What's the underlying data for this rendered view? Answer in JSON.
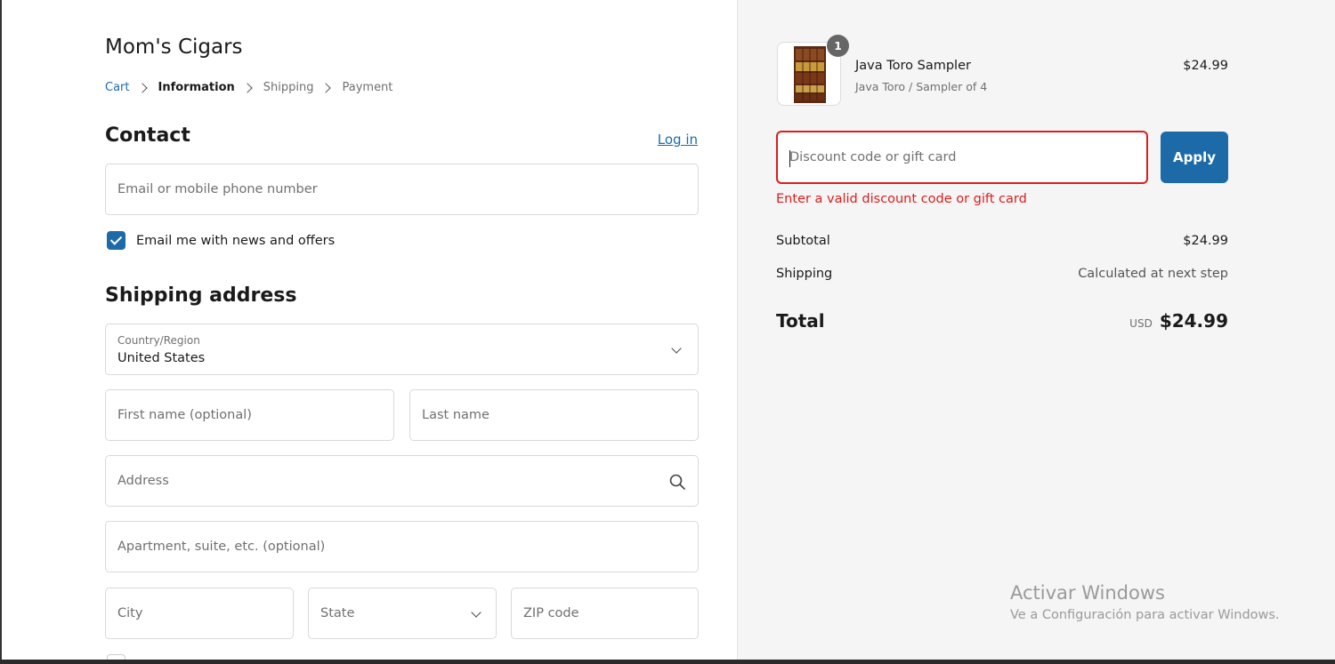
{
  "shop": {
    "name": "Mom's Cigars"
  },
  "breadcrumb": [
    "Cart",
    "Information",
    "Shipping",
    "Payment"
  ],
  "contact": {
    "title": "Contact",
    "login_label": "Log in",
    "email_placeholder": "Email or mobile phone number",
    "newsletter_label": "Email me with news and offers",
    "newsletter_checked": true
  },
  "shipping": {
    "title": "Shipping address",
    "country_label": "Country/Region",
    "country_value": "United States",
    "first_name_placeholder": "First name (optional)",
    "last_name_placeholder": "Last name",
    "address_placeholder": "Address",
    "apartment_placeholder": "Apartment, suite, etc. (optional)",
    "city_placeholder": "City",
    "state_placeholder": "State",
    "zip_placeholder": "ZIP code"
  },
  "order": {
    "product": {
      "name": "Java Toro Sampler",
      "variant": "Java Toro / Sampler of 4",
      "price": "$24.99",
      "quantity": "1"
    },
    "discount": {
      "placeholder": "Discount code or gift card",
      "apply_label": "Apply",
      "error": "Enter a valid discount code or gift card"
    },
    "subtotal_label": "Subtotal",
    "subtotal_value": "$24.99",
    "shipping_label": "Shipping",
    "shipping_value": "Calculated at next step",
    "total_label": "Total",
    "currency": "USD",
    "total_value": "$24.99"
  },
  "watermark": {
    "title": "Activar Windows",
    "subtitle": "Ve a Configuración para activar Windows."
  },
  "colors": {
    "accent": "#1c6ba8",
    "error": "#dd1d1d",
    "sidebar_bg": "#f5f5f5"
  }
}
